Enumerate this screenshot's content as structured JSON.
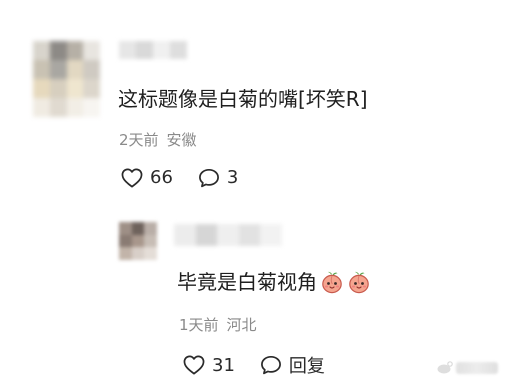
{
  "comment": {
    "text": "这标题像是白菊的嘴[坏笑R]",
    "time": "2天前",
    "location": "安徽",
    "likes": "66",
    "replies": "3"
  },
  "reply": {
    "text": "毕竟是白菊视角",
    "time": "1天前",
    "location": "河北",
    "likes": "31",
    "reply_label": "回复",
    "emojis": [
      "peach-face-emoji",
      "peach-face-emoji"
    ]
  },
  "colors": {
    "text_primary": "#1f1f1f",
    "text_meta": "#8a8a8a",
    "background": "#ffffff"
  },
  "icons": {
    "like": "heart-outline-icon",
    "comment": "speech-bubble-icon"
  }
}
